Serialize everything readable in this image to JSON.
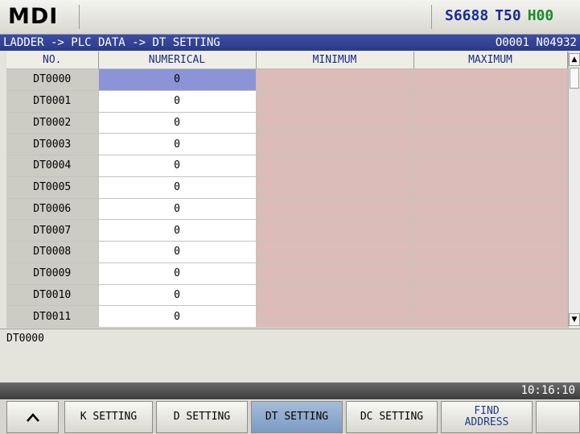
{
  "header": {
    "mode": "MDI",
    "spindle": "S6688",
    "tool": "T50",
    "offset": "H00"
  },
  "path": {
    "breadcrumb": "LADDER -> PLC DATA -> DT SETTING",
    "program": "O0001 N04932"
  },
  "table": {
    "columns": [
      "NO.",
      "NUMERICAL",
      "MINIMUM",
      "MAXIMUM"
    ],
    "rows": [
      {
        "no": "DT0000",
        "value": "0",
        "min": "",
        "max": ""
      },
      {
        "no": "DT0001",
        "value": "0",
        "min": "",
        "max": ""
      },
      {
        "no": "DT0002",
        "value": "0",
        "min": "",
        "max": ""
      },
      {
        "no": "DT0003",
        "value": "0",
        "min": "",
        "max": ""
      },
      {
        "no": "DT0004",
        "value": "0",
        "min": "",
        "max": ""
      },
      {
        "no": "DT0005",
        "value": "0",
        "min": "",
        "max": ""
      },
      {
        "no": "DT0006",
        "value": "0",
        "min": "",
        "max": ""
      },
      {
        "no": "DT0007",
        "value": "0",
        "min": "",
        "max": ""
      },
      {
        "no": "DT0008",
        "value": "0",
        "min": "",
        "max": ""
      },
      {
        "no": "DT0009",
        "value": "0",
        "min": "",
        "max": ""
      },
      {
        "no": "DT0010",
        "value": "0",
        "min": "",
        "max": ""
      },
      {
        "no": "DT0011",
        "value": "0",
        "min": "",
        "max": ""
      }
    ],
    "selected_index": 0
  },
  "info": {
    "message": "DT0000"
  },
  "status": {
    "time": "10:16:10"
  },
  "softkeys": {
    "k_setting": "K SETTING",
    "d_setting": "D SETTING",
    "dt_setting": "DT SETTING",
    "dc_setting": "DC SETTING",
    "find_line1": "FIND",
    "find_line2": "ADDRESS",
    "up_icon": "chevron-up-icon"
  },
  "colors": {
    "path_bar": "#2a3a8a",
    "selected_cell": "#8c94d8",
    "range_cells": "#dcbcb8",
    "active_softkey": "#7c9ac4"
  }
}
